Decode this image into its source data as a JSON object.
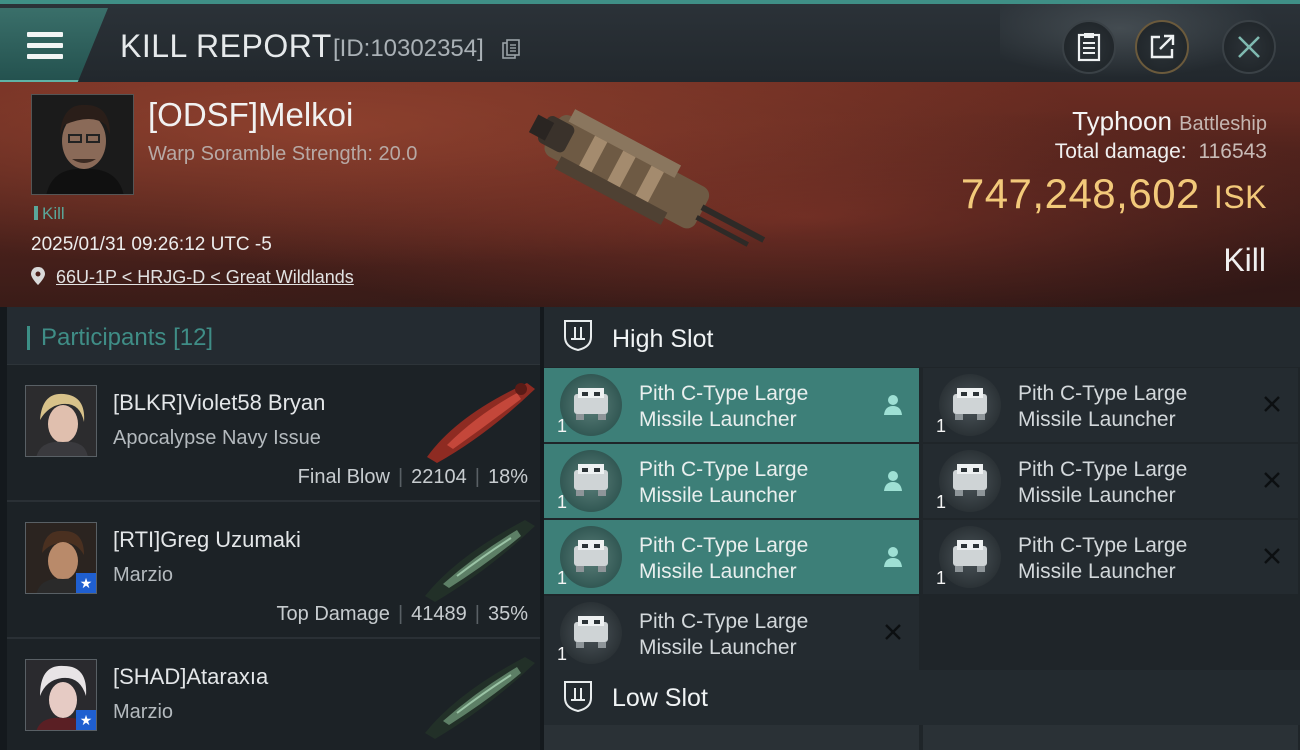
{
  "header": {
    "title": "KILL REPORT",
    "report_id": "[ID:10302354]",
    "icons": [
      "menu-icon",
      "copy-icon",
      "clipboard-icon",
      "share-icon",
      "close-icon"
    ]
  },
  "victim": {
    "name": "[ODSF]Melkoi",
    "scramble": "Warp Soramble Strength: 20.0",
    "tag": "Kill",
    "timestamp": "2025/01/31 09:26:12 UTC -5",
    "location": "66U-1P < HRJG-D < Great Wildlands",
    "ship_name": "Typhoon",
    "ship_class": "Battleship",
    "total_damage_label": "Total damage:",
    "total_damage": "116543",
    "isk_value": "747,248,602",
    "isk_unit": "ISK",
    "result": "Kill"
  },
  "participants": {
    "title": "Participants",
    "count": "[12]",
    "items": [
      {
        "name": "[BLKR]Violet58 Bryan",
        "ship": "Apocalypse Navy Issue",
        "role": "Final Blow",
        "damage": "22104",
        "percent": "18%"
      },
      {
        "name": "[RTI]Greg Uzumaki",
        "ship": "Marzio",
        "role": "Top Damage",
        "damage": "41489",
        "percent": "35%"
      },
      {
        "name": "[SHAD]Ataraxıa",
        "ship": "Marzio",
        "role": "",
        "damage": "",
        "percent": ""
      }
    ]
  },
  "fitting": {
    "high_slot_label": "High Slot",
    "low_slot_label": "Low Slot",
    "high_modules": [
      {
        "line1": "Pith C-Type Large",
        "line2": "Missile Launcher",
        "qty": "1",
        "status": "fitted"
      },
      {
        "line1": "Pith C-Type Large",
        "line2": "Missile Launcher",
        "qty": "1",
        "status": "destroyed"
      },
      {
        "line1": "Pith C-Type Large",
        "line2": "Missile Launcher",
        "qty": "1",
        "status": "fitted"
      },
      {
        "line1": "Pith C-Type Large",
        "line2": "Missile Launcher",
        "qty": "1",
        "status": "destroyed"
      },
      {
        "line1": "Pith C-Type Large",
        "line2": "Missile Launcher",
        "qty": "1",
        "status": "fitted"
      },
      {
        "line1": "Pith C-Type Large",
        "line2": "Missile Launcher",
        "qty": "1",
        "status": "destroyed"
      },
      {
        "line1": "Pith C-Type Large",
        "line2": "Missile Launcher",
        "qty": "1",
        "status": "destroyed"
      }
    ]
  },
  "colors": {
    "accent": "#3d7f78",
    "isk": "#f2c97a",
    "bg": "#14191d"
  }
}
